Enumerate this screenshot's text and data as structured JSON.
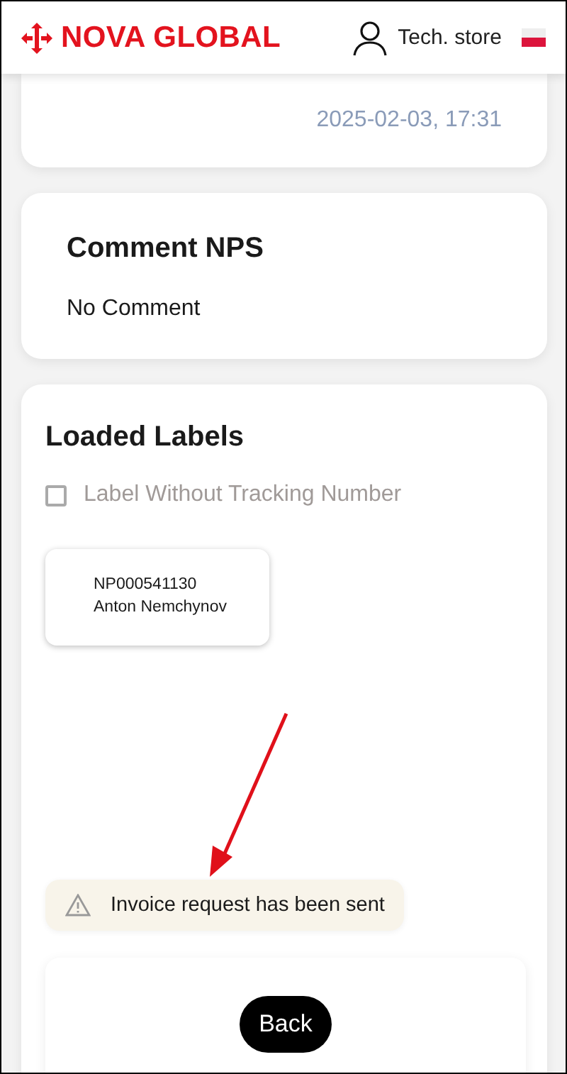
{
  "header": {
    "brand": "NOVA GLOBAL",
    "store": "Tech. store"
  },
  "order_card": {
    "date": "2025-02-03, 17:31"
  },
  "comment_card": {
    "title": "Comment NPS",
    "text": "No Comment"
  },
  "labels_card": {
    "title": "Loaded Labels",
    "without_tracking": {
      "label": "Label Without Tracking Number",
      "checked": false
    },
    "labels": [
      {
        "number": "NP000541130",
        "name": "Anton Nemchynov"
      }
    ],
    "notice": {
      "text": "Invoice request has been sent"
    },
    "back_button": "Back"
  }
}
